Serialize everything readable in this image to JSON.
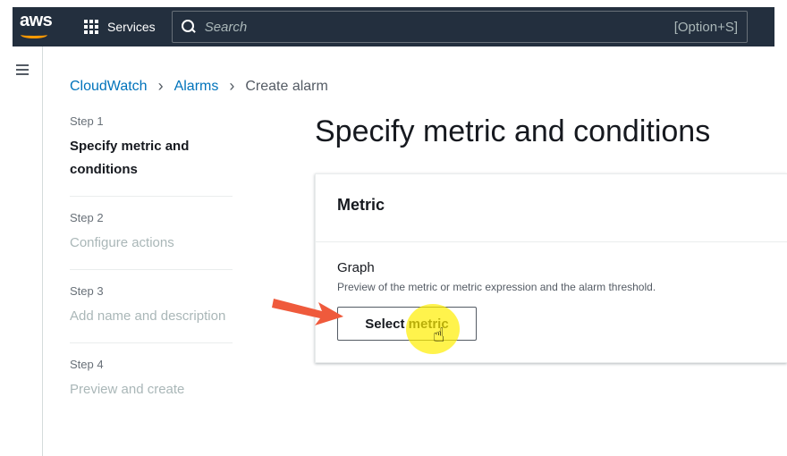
{
  "topnav": {
    "logo_text": "aws",
    "services_label": "Services",
    "search_placeholder": "Search",
    "search_shortcut": "[Option+S]"
  },
  "breadcrumb": {
    "items": [
      "CloudWatch",
      "Alarms"
    ],
    "current": "Create alarm"
  },
  "steps": [
    {
      "number": "Step 1",
      "title": "Specify metric and conditions",
      "active": true
    },
    {
      "number": "Step 2",
      "title": "Configure actions",
      "active": false
    },
    {
      "number": "Step 3",
      "title": "Add name and description",
      "active": false
    },
    {
      "number": "Step 4",
      "title": "Preview and create",
      "active": false
    }
  ],
  "main": {
    "page_title": "Specify metric and conditions",
    "card": {
      "header": "Metric",
      "graph_label": "Graph",
      "graph_description": "Preview of the metric or metric expression and the alarm threshold.",
      "select_button": "Select metric"
    }
  },
  "colors": {
    "nav_bg": "#232f3e",
    "link": "#0073bb",
    "brand": "#ff9900",
    "annotation_arrow": "#ef5a3c",
    "highlight": "#ffee00"
  },
  "icons": [
    "grid-icon",
    "search-icon",
    "menu-icon",
    "chevron-right-icon",
    "arrow-annotation",
    "pointer-hand-icon"
  ]
}
